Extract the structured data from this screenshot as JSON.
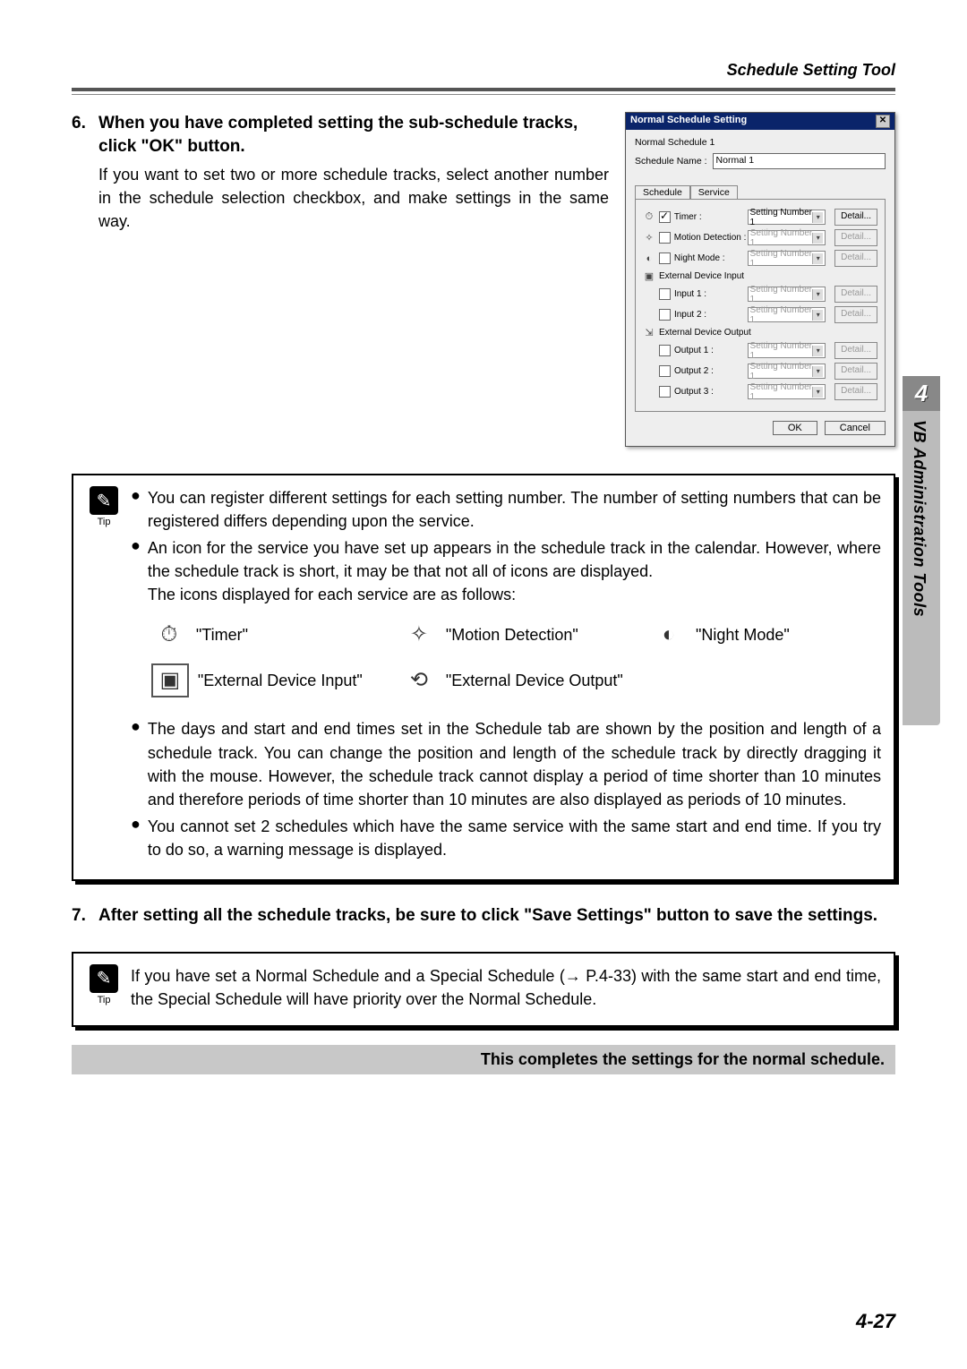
{
  "header": {
    "right": "Schedule Setting Tool"
  },
  "step6": {
    "num": "6.",
    "title": "When you have completed setting the sub-schedule tracks, click \"OK\" button.",
    "body": "If you want to set two or more schedule tracks, select another number in the schedule selection checkbox, and make settings in the same way."
  },
  "dialog": {
    "title": "Normal Schedule Setting",
    "subtitle": "Normal Schedule 1",
    "name_label": "Schedule Name :",
    "name_value": "Normal 1",
    "tabs": {
      "schedule": "Schedule",
      "service": "Service"
    },
    "option_text": "Setting Number 1",
    "detail_text": "Detail...",
    "rows": {
      "timer": "Timer :",
      "motion": "Motion Detection :",
      "night": "Night Mode :",
      "ext_in_hdr": "External Device Input",
      "input1": "Input 1 :",
      "input2": "Input 2 :",
      "ext_out_hdr": "External Device Output",
      "output1": "Output 1 :",
      "output2": "Output 2 :",
      "output3": "Output 3 :"
    },
    "ok": "OK",
    "cancel": "Cancel"
  },
  "tip1": {
    "label": "Tip",
    "b1": "You can register different settings for each setting number. The number of setting numbers that can be registered differs depending upon the service.",
    "b2": "An icon for the service you have set up appears in the schedule track in the calendar. However, where the schedule track is short, it may be that not all of icons are displayed.",
    "b2b": "The icons displayed for each service are as follows:",
    "legend": {
      "timer": "\"Timer\"",
      "motion": "\"Motion Detection\"",
      "night": "\"Night Mode\"",
      "ext_in": "\"External Device Input\"",
      "ext_out": "\"External Device Output\""
    },
    "b3": "The days and start and end times set in the Schedule tab are shown by the position and length of a schedule track. You can change the position and length of the schedule track by directly dragging it with the mouse. However, the schedule track cannot display a period of time shorter than 10 minutes and therefore periods of time shorter than 10 minutes are also displayed as periods of 10 minutes.",
    "b4": "You cannot set 2 schedules which have the same service with the same start and end time. If you try to do so, a warning message is displayed."
  },
  "step7": {
    "num": "7.",
    "title": "After setting all the schedule tracks, be sure to click \"Save Settings\" button to save the settings."
  },
  "tip2": {
    "label": "Tip",
    "body": "If you have set a Normal Schedule and a Special Schedule (→ P.4-33) with the same start and end time, the Special Schedule will have priority over the Normal Schedule."
  },
  "completion": "This completes the settings for the normal schedule.",
  "sidetab": {
    "num": "4",
    "label": "VB Administration Tools"
  },
  "pagenum": "4-27"
}
